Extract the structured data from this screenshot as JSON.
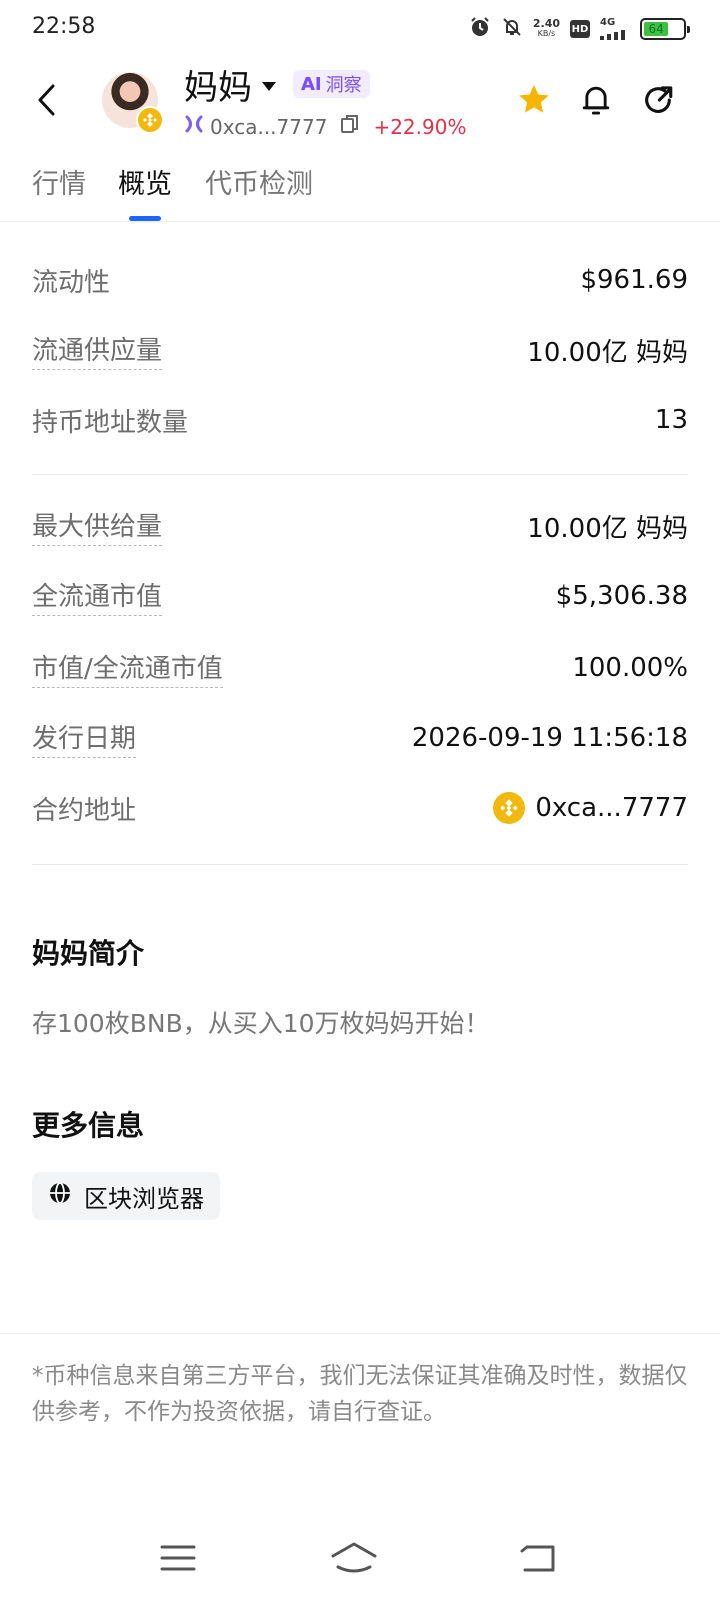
{
  "status_bar": {
    "time": "22:58",
    "net_speed": "2.40",
    "net_speed_unit": "KB/s",
    "hd": "HD",
    "network": "4G",
    "battery": "64",
    "battery_level_percent": 64
  },
  "header": {
    "token_name": "妈妈",
    "ai_tag_prefix": "AI",
    "ai_tag_label": "洞察",
    "address_short": "0xca...7777",
    "price_change": "+22.90%",
    "colors": {
      "price_up": "#e0324b",
      "favorite": "#f7b500",
      "bnb": "#f0b90b"
    }
  },
  "tabs": [
    {
      "label": "行情",
      "active": false
    },
    {
      "label": "概览",
      "active": true
    },
    {
      "label": "代币检测",
      "active": false
    }
  ],
  "metrics": {
    "liquidity": {
      "label": "流动性",
      "value": "$961.69"
    },
    "circulating_supply": {
      "label": "流通供应量",
      "value": "10.00亿 妈妈"
    },
    "holders": {
      "label": "持币地址数量",
      "value": "13"
    },
    "max_supply": {
      "label": "最大供给量",
      "value": "10.00亿 妈妈"
    },
    "fdv": {
      "label": "全流通市值",
      "value": "$5,306.38"
    },
    "mc_fdv": {
      "label": "市值/全流通市值",
      "value": "100.00%"
    },
    "issue_date": {
      "label": "发行日期",
      "value": "2026-09-19 11:56:18"
    },
    "contract": {
      "label": "合约地址",
      "value": "0xca...7777"
    }
  },
  "intro": {
    "title": "妈妈简介",
    "text": "存100枚BNB，从买入10万枚妈妈开始！"
  },
  "more_info": {
    "title": "更多信息",
    "explorer_label": "区块浏览器"
  },
  "disclaimer": "*币种信息来自第三方平台，我们无法保证其准确及时性，数据仅供参考，不作为投资依据，请自行查证。"
}
